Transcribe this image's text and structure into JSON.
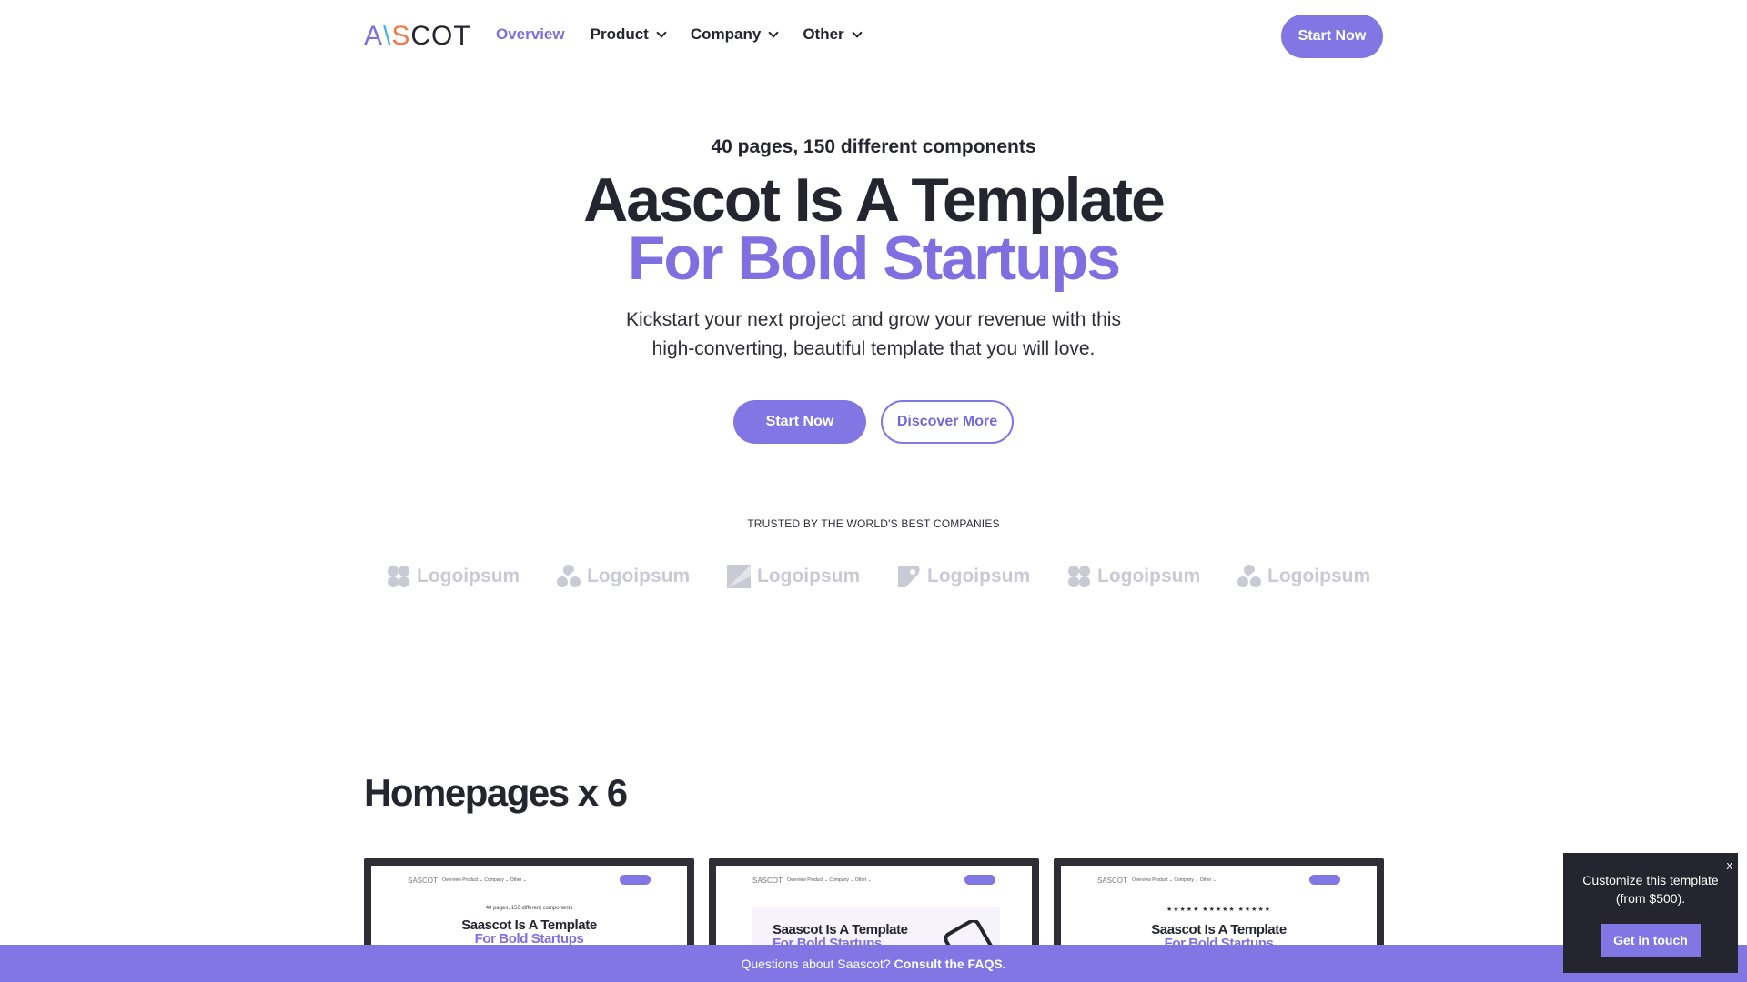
{
  "header": {
    "logo": {
      "letters": [
        "A",
        "\\",
        "S",
        "COT"
      ],
      "colors": [
        "#7d6fe0",
        "#3fb5e8",
        "#f07a4a",
        "#24252f"
      ]
    },
    "nav": [
      {
        "label": "Overview",
        "active": true,
        "dropdown": false
      },
      {
        "label": "Product",
        "active": false,
        "dropdown": true
      },
      {
        "label": "Company",
        "active": false,
        "dropdown": true
      },
      {
        "label": "Other",
        "active": false,
        "dropdown": true
      }
    ],
    "cta_label": "Start Now"
  },
  "hero": {
    "eyebrow": "40 pages, 150 different components",
    "title_line1": "Aascot Is A Template",
    "title_line2": "For Bold Startups",
    "lead_line1": "Kickstart your next project and grow your revenue with this",
    "lead_line2": "high-converting, beautiful template that you will love.",
    "primary_label": "Start Now",
    "secondary_label": "Discover More"
  },
  "trusted": {
    "label": "TRUSTED BY THE WORLD'S BEST COMPANIES",
    "logos": [
      "Logoipsum",
      "Logoipsum",
      "Logoipsum",
      "Logoipsum",
      "Logoipsum",
      "Logoipsum"
    ]
  },
  "homepages": {
    "title": "Homepages x 6",
    "thumbnails": [
      {
        "eyebrow": "40 pages, 150 different components",
        "title1": "Saascot Is A Template",
        "title2": "For Bold Startups"
      },
      {
        "title1": "Saascot Is A Template",
        "title2": "For Bold Startups"
      },
      {
        "stars": "★★★★★   ★★★★★   ★★★★★",
        "title1": "Saascot Is A Template",
        "title2": "For Bold Startups"
      }
    ],
    "mini_logo": "SASCOT",
    "mini_nav": "Overview   Product ⌄   Company ⌄   Other ⌄"
  },
  "faq_bar": {
    "text": "Questions about Saascot?",
    "link": "Consult the FAQS."
  },
  "popup": {
    "close": "x",
    "text_line1": "Customize this template",
    "text_line2": "(from $500).",
    "button": "Get in touch"
  },
  "colors": {
    "accent": "#8176e4",
    "dark": "#24252f",
    "logo_gray": "#c9cad3"
  }
}
